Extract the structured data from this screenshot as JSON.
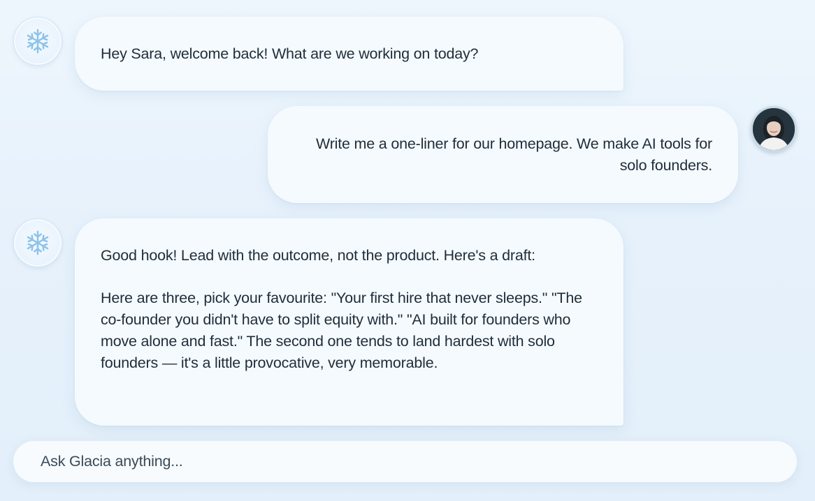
{
  "assistant": {
    "name": "Glacia",
    "avatar_icon": "snowflake-icon"
  },
  "user": {
    "name": "Sara",
    "avatar_icon": "user-photo"
  },
  "messages": [
    {
      "role": "assistant",
      "paragraphs": [
        "Hey Sara, welcome back! What are we working on today?"
      ]
    },
    {
      "role": "user",
      "paragraphs": [
        "Write me a one-liner for our homepage. We make AI tools for solo founders."
      ]
    },
    {
      "role": "assistant",
      "paragraphs": [
        "Good hook! Lead with the outcome, not the product. Here's a draft:",
        "Here are three, pick your favourite: \"Your first hire that never sleeps.\" \"The co-founder you didn't have to split equity with.\" \"AI built for founders who move alone and fast.\" The second one tends to land hardest with solo founders — it's a little provocative, very memorable."
      ]
    }
  ],
  "composer": {
    "placeholder": "Ask Glacia anything..."
  },
  "colors": {
    "background": "#e6f1fb",
    "bubble": "#f5fafe",
    "text": "#1f2d3a",
    "snowflake": "#8cc3ea"
  }
}
